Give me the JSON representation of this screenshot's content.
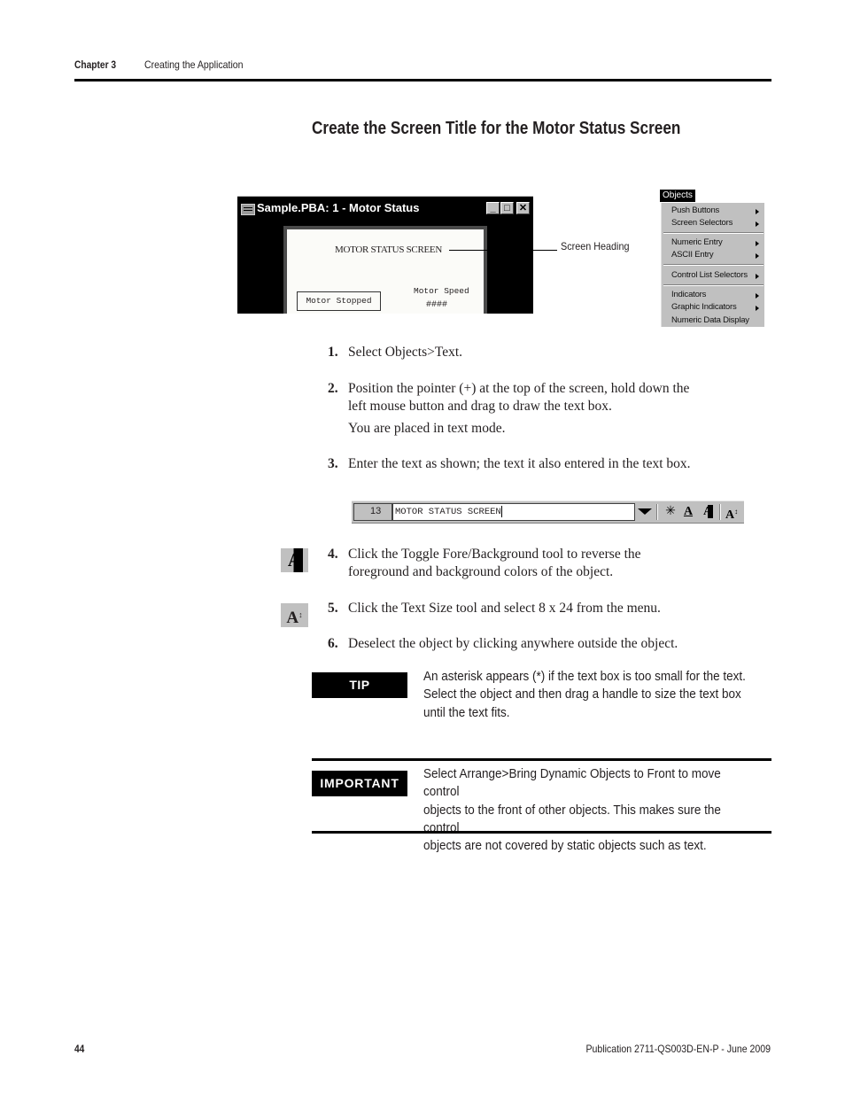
{
  "header": {
    "chapter": "Chapter 3",
    "chapter_title": "Creating the Application"
  },
  "section_title": "Create the Screen Title for the Motor Status Screen",
  "window": {
    "title": "Sample.PBA: 1 - Motor Status",
    "buttons": {
      "minimize": "_",
      "maximize": "□",
      "close": "✕"
    },
    "screen_heading": "MOTOR STATUS SCREEN",
    "motor_stopped": "Motor Stopped",
    "motor_speed_label": "Motor Speed",
    "motor_speed_value": "####"
  },
  "callout": {
    "label": "Screen Heading"
  },
  "objects_menu": {
    "title": "Objects",
    "items": [
      {
        "label": "Push Buttons",
        "submenu": true
      },
      {
        "label": "Screen Selectors",
        "submenu": true
      },
      {
        "label": "Numeric Entry",
        "submenu": true
      },
      {
        "label": "ASCII Entry",
        "submenu": true
      },
      {
        "label": "Control List Selectors",
        "submenu": true
      },
      {
        "label": "Indicators",
        "submenu": true
      },
      {
        "label": "Graphic Indicators",
        "submenu": true
      },
      {
        "label": "Numeric Data Display",
        "submenu": false
      }
    ]
  },
  "steps": [
    {
      "num": "1.",
      "lines": [
        "Select Objects>Text."
      ]
    },
    {
      "num": "2.",
      "lines": [
        "Position the pointer (+) at the top of the screen, hold down the",
        "left mouse button and drag to draw the text box.",
        "You are placed in text mode."
      ]
    },
    {
      "num": "3.",
      "lines": [
        "Enter the text as shown; the text it also entered in the text box."
      ]
    },
    {
      "num": "4.",
      "lines": [
        "Click the Toggle Fore/Background tool to reverse the",
        "foreground and background colors of the object."
      ]
    },
    {
      "num": "5.",
      "lines": [
        "Click the Text Size tool and select 8 x 24 from the menu."
      ]
    },
    {
      "num": "6.",
      "lines": [
        "Deselect the object by clicking anywhere outside the object."
      ]
    }
  ],
  "text_toolbar": {
    "size_value": "13",
    "text_value": "MOTOR STATUS SCREEN",
    "icons": [
      "blink-icon",
      "underline-icon",
      "toggle-fore-background-icon",
      "text-size-icon"
    ]
  },
  "margin_icons": {
    "toggle": "A",
    "size": "A"
  },
  "tip": {
    "label": "TIP",
    "lines": [
      "An asterisk appears (*) if the text box is too small for the text.",
      "Select the object and then drag a handle to size the text box",
      "until the text fits."
    ]
  },
  "important": {
    "label": "IMPORTANT",
    "lines": [
      "Select Arrange>Bring Dynamic Objects to Front to move control",
      "objects to the front of other objects. This makes sure the control",
      "objects are not covered by static objects such as text."
    ]
  },
  "footer": {
    "page_number": "44",
    "publication": "Publication 2711-QS003D-EN-P - June 2009"
  }
}
